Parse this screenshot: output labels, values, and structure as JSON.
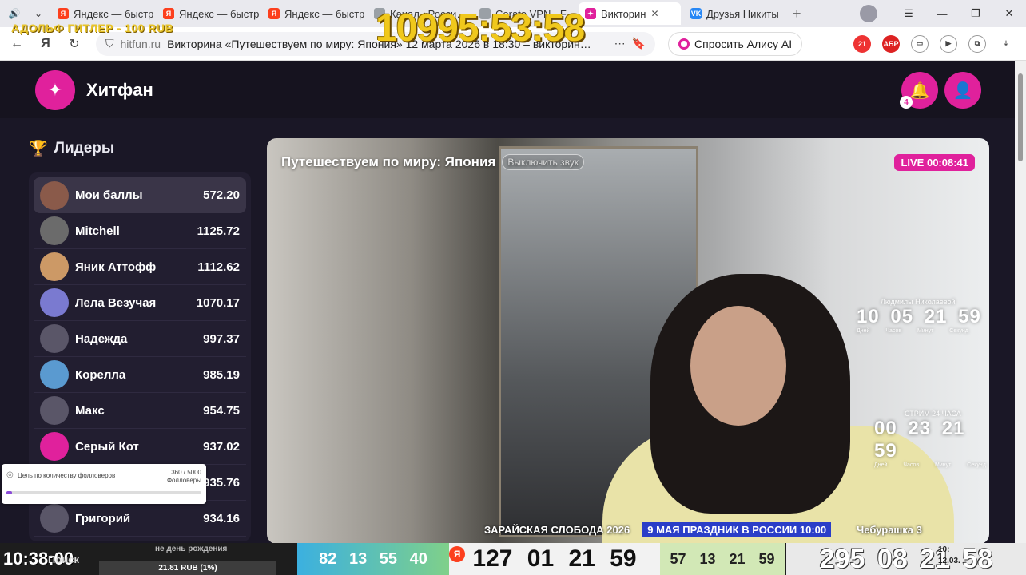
{
  "browser": {
    "tabs": [
      {
        "label": "Яндекс — быстр",
        "icon": "yandex-icon",
        "kind": "ya"
      },
      {
        "label": "Яндекс — быстр",
        "icon": "yandex-icon",
        "kind": "ya"
      },
      {
        "label": "Яндекс — быстр",
        "icon": "yandex-icon",
        "kind": "ya"
      },
      {
        "label": "Канал «Росси…",
        "icon": "page-icon",
        "kind": "gen"
      },
      {
        "label": "Cerato VPN · F",
        "icon": "vpn-icon",
        "kind": "gen"
      },
      {
        "label": "Викторин",
        "icon": "hitfun-icon",
        "kind": "hf",
        "active": true
      },
      {
        "label": "Друзья Никиты",
        "icon": "vk-icon",
        "kind": "vk"
      }
    ],
    "domain": "hitfun.ru",
    "page_title": "Викторина «Путешествуем по миру: Япония» 12 марта 2026 в 18:30 – викторин…",
    "alice_label": "Спросить Алису AI",
    "addr_icons": [
      "21",
      "АБР"
    ]
  },
  "overlay": {
    "donate": "АДОЛЬФ ГИТЛЕР - 100 RUB",
    "big_timer": "10995:53:58"
  },
  "site": {
    "brand": "Хитфан",
    "notif_count": "4",
    "leaders_title": "Лидеры",
    "leaders": [
      {
        "name": "Мои баллы",
        "score": "572.20",
        "me": true
      },
      {
        "name": "Mitchell",
        "score": "1125.72"
      },
      {
        "name": "Яник Аттофф",
        "score": "1112.62"
      },
      {
        "name": "Лела Везучая",
        "score": "1070.17"
      },
      {
        "name": "Надежда",
        "score": "997.37"
      },
      {
        "name": "Корелла",
        "score": "985.19"
      },
      {
        "name": "Макс",
        "score": "954.75"
      },
      {
        "name": "Серый Кот",
        "score": "937.02"
      },
      {
        "name": "",
        "score": "935.76"
      },
      {
        "name": "Григорий",
        "score": "934.16"
      }
    ]
  },
  "video": {
    "title": "Путешествуем по миру: Япония",
    "mute_label": "Выключить звук",
    "live_label": "LIVE 00:08:41",
    "countdown1": {
      "caption": "Людмилы Николаевой",
      "value": "10 05 21 59",
      "units": "Дней Часов Минут Секунд"
    },
    "countdown2": {
      "caption": "СТРИМ 24 ЧАСА",
      "value": "00 23 21 59",
      "units": "Дней Часов Минут Секунд"
    },
    "ticker1": "ЗАРАЙСКАЯ СЛОБОДА 2026",
    "ticker2": "9 МАЯ ПРАЗДНИК В РОССИИ 10:00",
    "ticker3": "Чебурашка 3"
  },
  "goal": {
    "label": "Цель по количеству фолловеров",
    "value": "360 / 5000",
    "sub": "Фолловеры",
    "progress": 0.03
  },
  "bottom": {
    "clock": "10:38:00",
    "search": "Поиск",
    "birthday": "не день рождения",
    "rub": "21.81 RUB (1%)",
    "timer1": "82 13 55 40",
    "timer2": "127 01 21 59",
    "timer3": "57 13 21 59",
    "timer4": "295 08 21 58",
    "sys_time": "10:",
    "sys_date": "12.03."
  },
  "colors": {
    "accent": "#e0219c",
    "bg": "#1a1726",
    "timer": "#f0c81c"
  }
}
